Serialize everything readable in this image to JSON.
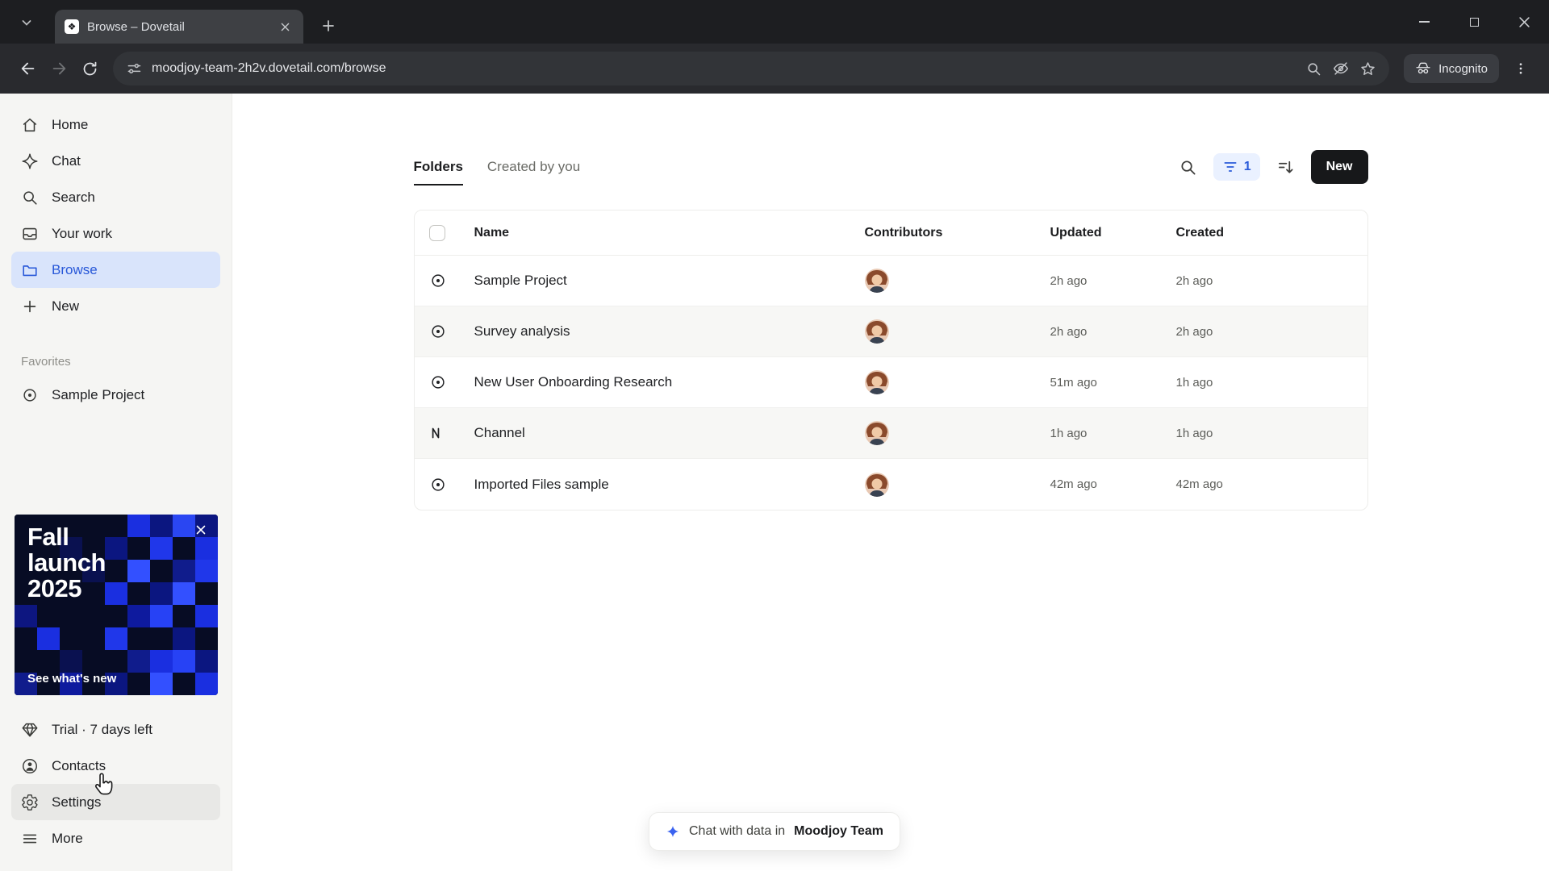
{
  "browser": {
    "tab_title": "Browse – Dovetail",
    "url": "moodjoy-team-2h2v.dovetail.com/browse",
    "incognito_label": "Incognito"
  },
  "sidebar": {
    "items": [
      {
        "label": "Home"
      },
      {
        "label": "Chat"
      },
      {
        "label": "Search"
      },
      {
        "label": "Your work"
      },
      {
        "label": "Browse"
      },
      {
        "label": "New"
      }
    ],
    "favorites_label": "Favorites",
    "favorites": [
      {
        "label": "Sample Project"
      }
    ],
    "promo": {
      "title_lines": [
        "Fall",
        "launch",
        "2025"
      ],
      "link": "See what's new"
    },
    "footer_items": [
      {
        "label": "Trial · 7 days left"
      },
      {
        "label": "Contacts"
      },
      {
        "label": "Settings"
      },
      {
        "label": "More"
      }
    ]
  },
  "main": {
    "tabs": [
      {
        "label": "Folders"
      },
      {
        "label": "Created by you"
      }
    ],
    "filter_count": "1",
    "new_button_label": "New",
    "table": {
      "headers": {
        "name": "Name",
        "contributors": "Contributors",
        "updated": "Updated",
        "created": "Created"
      },
      "rows": [
        {
          "name": "Sample Project",
          "icon": "target",
          "updated": "2h ago",
          "created": "2h ago"
        },
        {
          "name": "Survey analysis",
          "icon": "target",
          "updated": "2h ago",
          "created": "2h ago"
        },
        {
          "name": "New User Onboarding Research",
          "icon": "target",
          "updated": "51m ago",
          "created": "1h ago"
        },
        {
          "name": "Channel",
          "icon": "channel",
          "updated": "1h ago",
          "created": "1h ago"
        },
        {
          "name": "Imported Files sample",
          "icon": "target",
          "updated": "42m ago",
          "created": "42m ago"
        }
      ]
    }
  },
  "chat_pill": {
    "prefix": "Chat with data in",
    "team": "Moodjoy Team"
  }
}
